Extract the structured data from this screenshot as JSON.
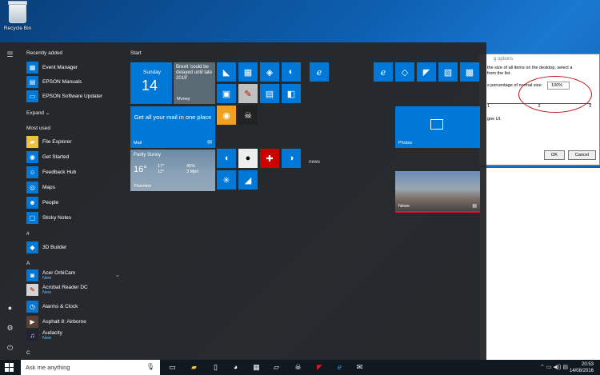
{
  "desktop": {
    "recycle_bin": "Recycle Bin"
  },
  "dialog": {
    "title": "g options",
    "text1": "the size of all items on the desktop, select a",
    "text2": "from the list.",
    "row_label": "s percentage of normal size:",
    "select_value": "100%",
    "tick_1": "1",
    "tick_2": "2",
    "tick_3": "3",
    "text3": "goe UI.",
    "ok": "OK",
    "cancel": "Cancel",
    "annotation_color": "#c0171b"
  },
  "start": {
    "recently_added": "Recently added",
    "expand": "Expand",
    "most_used": "Most used",
    "tiles_title": "Start",
    "recent_apps": [
      {
        "label": "Event Manager"
      },
      {
        "label": "EPSON Manuals"
      },
      {
        "label": "EPSON Software Updater"
      }
    ],
    "most_used_apps": [
      {
        "label": "File Explorer"
      },
      {
        "label": "Get Started"
      },
      {
        "label": "Feedback Hub"
      },
      {
        "label": "Maps"
      },
      {
        "label": "People"
      },
      {
        "label": "Sticky Notes"
      }
    ],
    "hash": "#",
    "app_3d": "3D Builder",
    "letter_a": "A",
    "a_apps": [
      {
        "label": "Acer OrbiCam",
        "badge": "New"
      },
      {
        "label": "Acrobat Reader DC",
        "badge": "New"
      },
      {
        "label": "Alarms & Clock",
        "badge": ""
      },
      {
        "label": "Asphalt 8: Airborne",
        "badge": ""
      },
      {
        "label": "Audacity",
        "badge": "New"
      }
    ],
    "letter_c": "C",
    "calendar": {
      "day": "Sunday",
      "num": "14"
    },
    "money": {
      "headline": "Brexit 'could be delayed until late 2019'",
      "label": "Money"
    },
    "mail": {
      "text": "Get all your mail in one place",
      "label": "Mail"
    },
    "weather": {
      "cond": "Partly Sunny",
      "temp": "16°",
      "hi": "17°",
      "lo": "12°",
      "hum": "45%",
      "wind": "3 Mph",
      "city": "Thornton"
    },
    "photos": "Photos",
    "news": "News",
    "news_label": "news",
    "accent": "#0078d7"
  },
  "taskbar": {
    "search_placeholder": "Ask me anything",
    "time": "20:53",
    "date": "14/08/2016"
  }
}
